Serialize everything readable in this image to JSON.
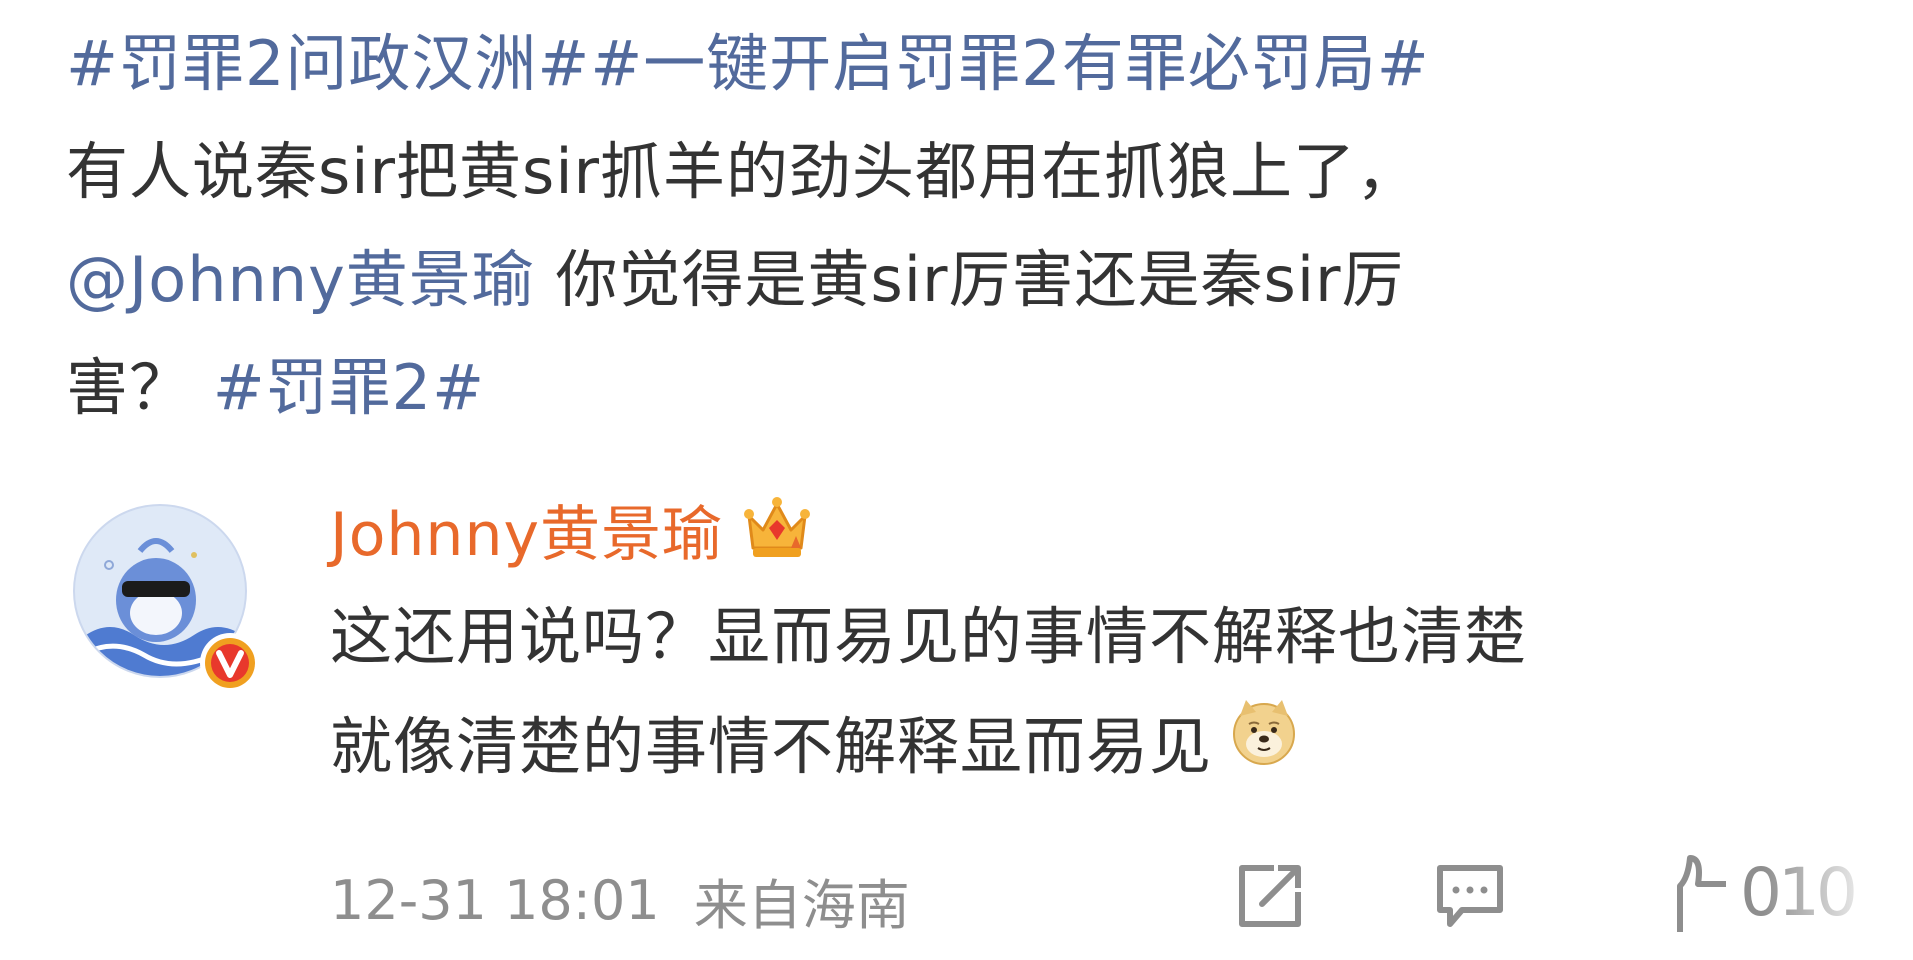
{
  "post": {
    "line1": {
      "topic1": "#罚罪2问政汉洲#",
      "topic2": "#一键开启罚罪2有罪必罚局#"
    },
    "line2": "有人说秦sir把黄sir抓羊的劲头都用在抓狼上了，",
    "line3": {
      "mention": "@Johnny黄景瑜",
      "text": " 你觉得是黄sir厉害还是秦sir厉"
    },
    "line4": {
      "text": "害？",
      "topic": "#罚罪2#"
    }
  },
  "reply": {
    "username": "Johnny黄景瑜",
    "badge_icon": "crown-icon",
    "verified_icon": "verified-v-icon",
    "line1": "这还用说吗？显而易见的事情不解释也清楚",
    "line2": "就像清楚的事情不解释显而易见",
    "emoji_icon": "doge-icon"
  },
  "meta": {
    "time": "12-31 18:01",
    "location": "来自海南"
  },
  "actions": {
    "share_icon": "share-icon",
    "comment_icon": "comment-icon",
    "like_icon": "like-icon",
    "like_count": "010"
  },
  "colors": {
    "link": "#526a9c",
    "username": "#e8692b",
    "text": "#333333",
    "meta": "#8e8e8e",
    "verified": "#f0a020"
  }
}
